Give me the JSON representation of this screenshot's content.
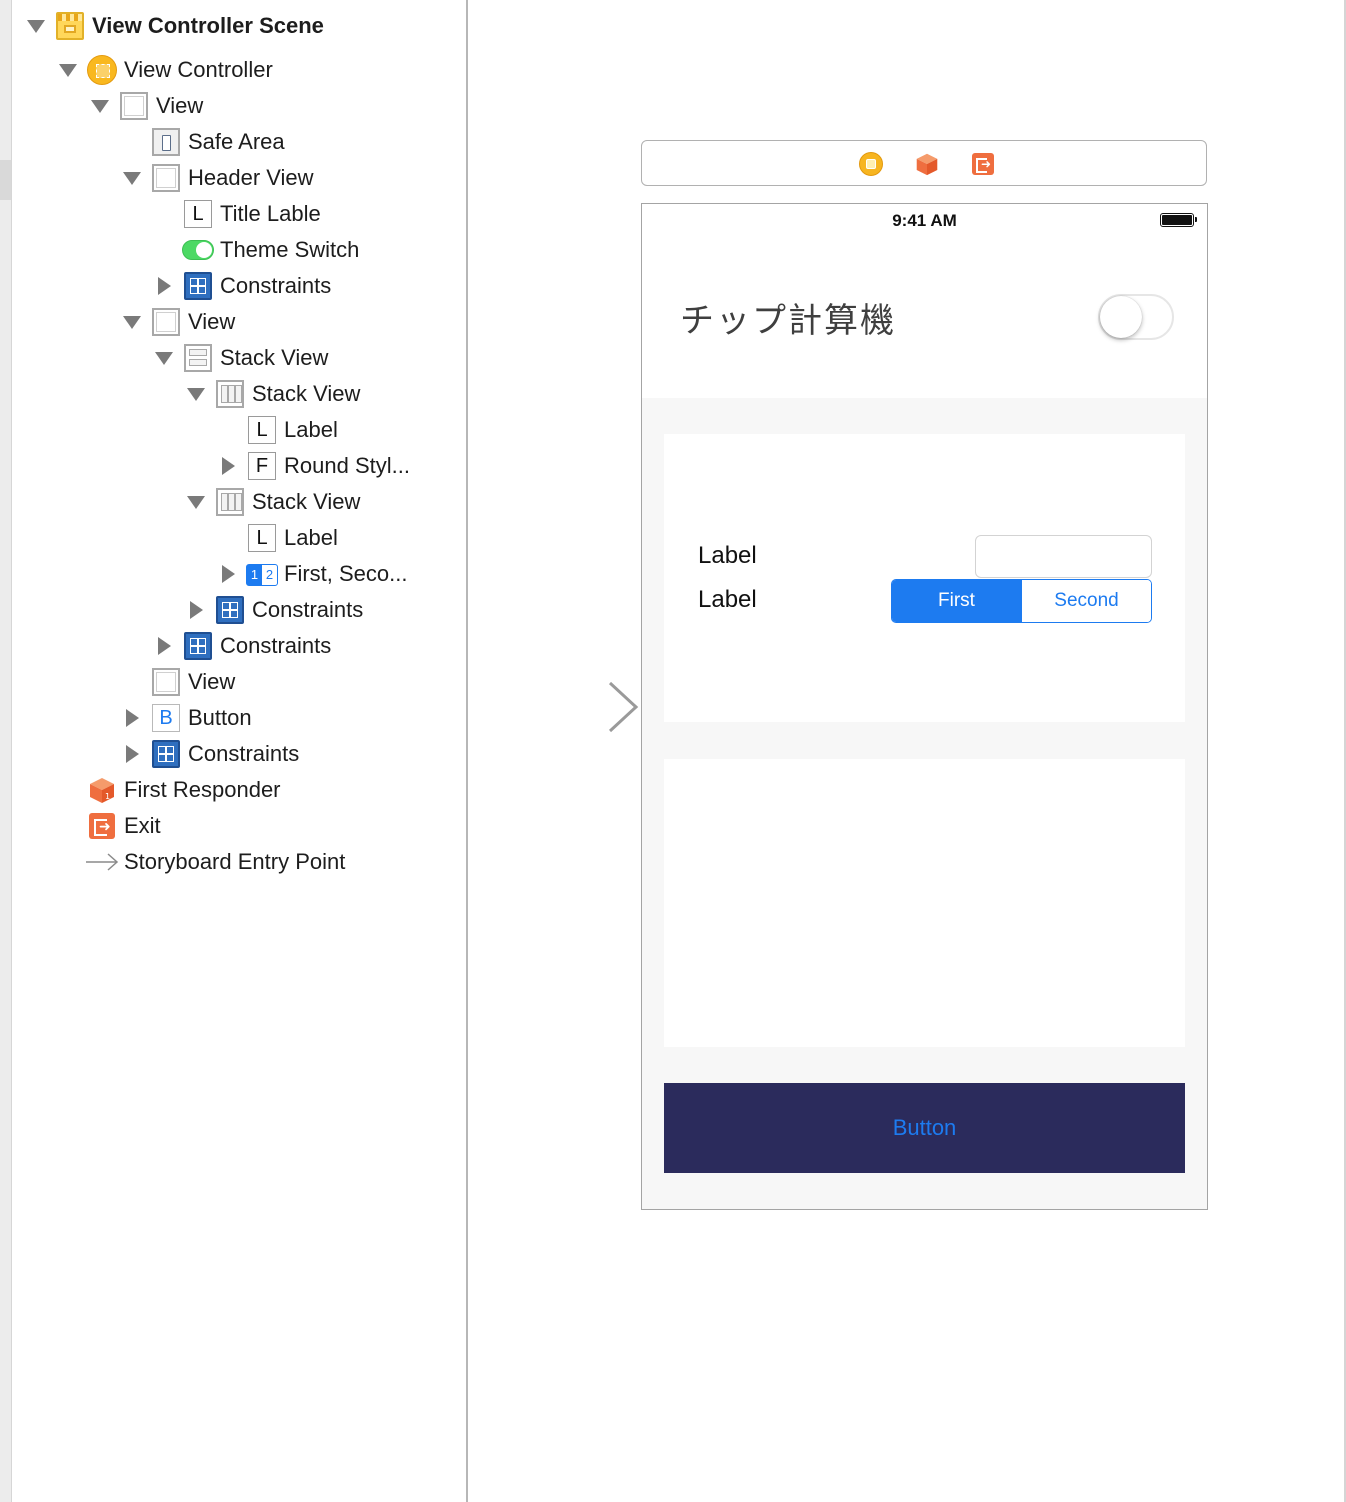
{
  "outline": {
    "items": [
      {
        "label": "View Controller Scene",
        "icon": "storyboard-scene-icon",
        "disclosure": "expanded"
      },
      {
        "label": "View Controller",
        "icon": "view-controller-icon",
        "disclosure": "expanded"
      },
      {
        "label": "View",
        "icon": "view-icon",
        "disclosure": "expanded"
      },
      {
        "label": "Safe Area",
        "icon": "safe-area-icon",
        "disclosure": "none"
      },
      {
        "label": "Header View",
        "icon": "view-icon",
        "disclosure": "expanded"
      },
      {
        "label": "Title Lable",
        "icon": "label-icon",
        "icon_letter": "L",
        "disclosure": "none"
      },
      {
        "label": "Theme Switch",
        "icon": "switch-icon",
        "disclosure": "none"
      },
      {
        "label": "Constraints",
        "icon": "constraints-icon",
        "disclosure": "collapsed"
      },
      {
        "label": "View",
        "icon": "view-icon",
        "disclosure": "expanded"
      },
      {
        "label": "Stack View",
        "icon": "vertical-stack-view-icon",
        "disclosure": "expanded"
      },
      {
        "label": "Stack View",
        "icon": "horizontal-stack-view-icon",
        "disclosure": "expanded"
      },
      {
        "label": "Label",
        "icon": "label-icon",
        "icon_letter": "L",
        "disclosure": "none"
      },
      {
        "label": "Round Styl...",
        "icon": "text-field-icon",
        "icon_letter": "F",
        "disclosure": "collapsed"
      },
      {
        "label": "Stack View",
        "icon": "horizontal-stack-view-icon",
        "disclosure": "expanded"
      },
      {
        "label": "Label",
        "icon": "label-icon",
        "icon_letter": "L",
        "disclosure": "none"
      },
      {
        "label": "First, Seco...",
        "icon": "segmented-control-icon",
        "icon_segments": [
          "1",
          "2"
        ],
        "disclosure": "collapsed"
      },
      {
        "label": "Constraints",
        "icon": "constraints-icon",
        "disclosure": "collapsed"
      },
      {
        "label": "Constraints",
        "icon": "constraints-icon",
        "disclosure": "collapsed"
      },
      {
        "label": "View",
        "icon": "view-icon",
        "disclosure": "none"
      },
      {
        "label": "Button",
        "icon": "button-icon",
        "icon_letter": "B",
        "disclosure": "collapsed"
      },
      {
        "label": "Constraints",
        "icon": "constraints-icon",
        "disclosure": "collapsed"
      },
      {
        "label": "First Responder",
        "icon": "first-responder-icon",
        "disclosure": "none"
      },
      {
        "label": "Exit",
        "icon": "exit-icon",
        "disclosure": "none"
      },
      {
        "label": "Storyboard Entry Point",
        "icon": "entry-point-arrow-icon",
        "disclosure": "none"
      }
    ]
  },
  "canvas": {
    "dock_icons": [
      "view-controller-icon",
      "first-responder-icon",
      "exit-icon"
    ],
    "entry_arrow_icon": "storyboard-entry-arrow-icon",
    "status_bar": {
      "time": "9:41 AM",
      "battery_icon": "battery-full-icon"
    },
    "header": {
      "title": "チップ計算機",
      "switch_on": false
    },
    "input_card": {
      "label_1": "Label",
      "label_2": "Label",
      "text_field_value": "",
      "segments": [
        {
          "label": "First",
          "selected": true
        },
        {
          "label": "Second",
          "selected": false
        }
      ]
    },
    "button_label": "Button"
  },
  "colors": {
    "accent_blue": "#1d7bf0",
    "button_background": "#2b2b5c",
    "canvas_background": "#f7f7f7",
    "switch_on_green": "#4cd964"
  }
}
